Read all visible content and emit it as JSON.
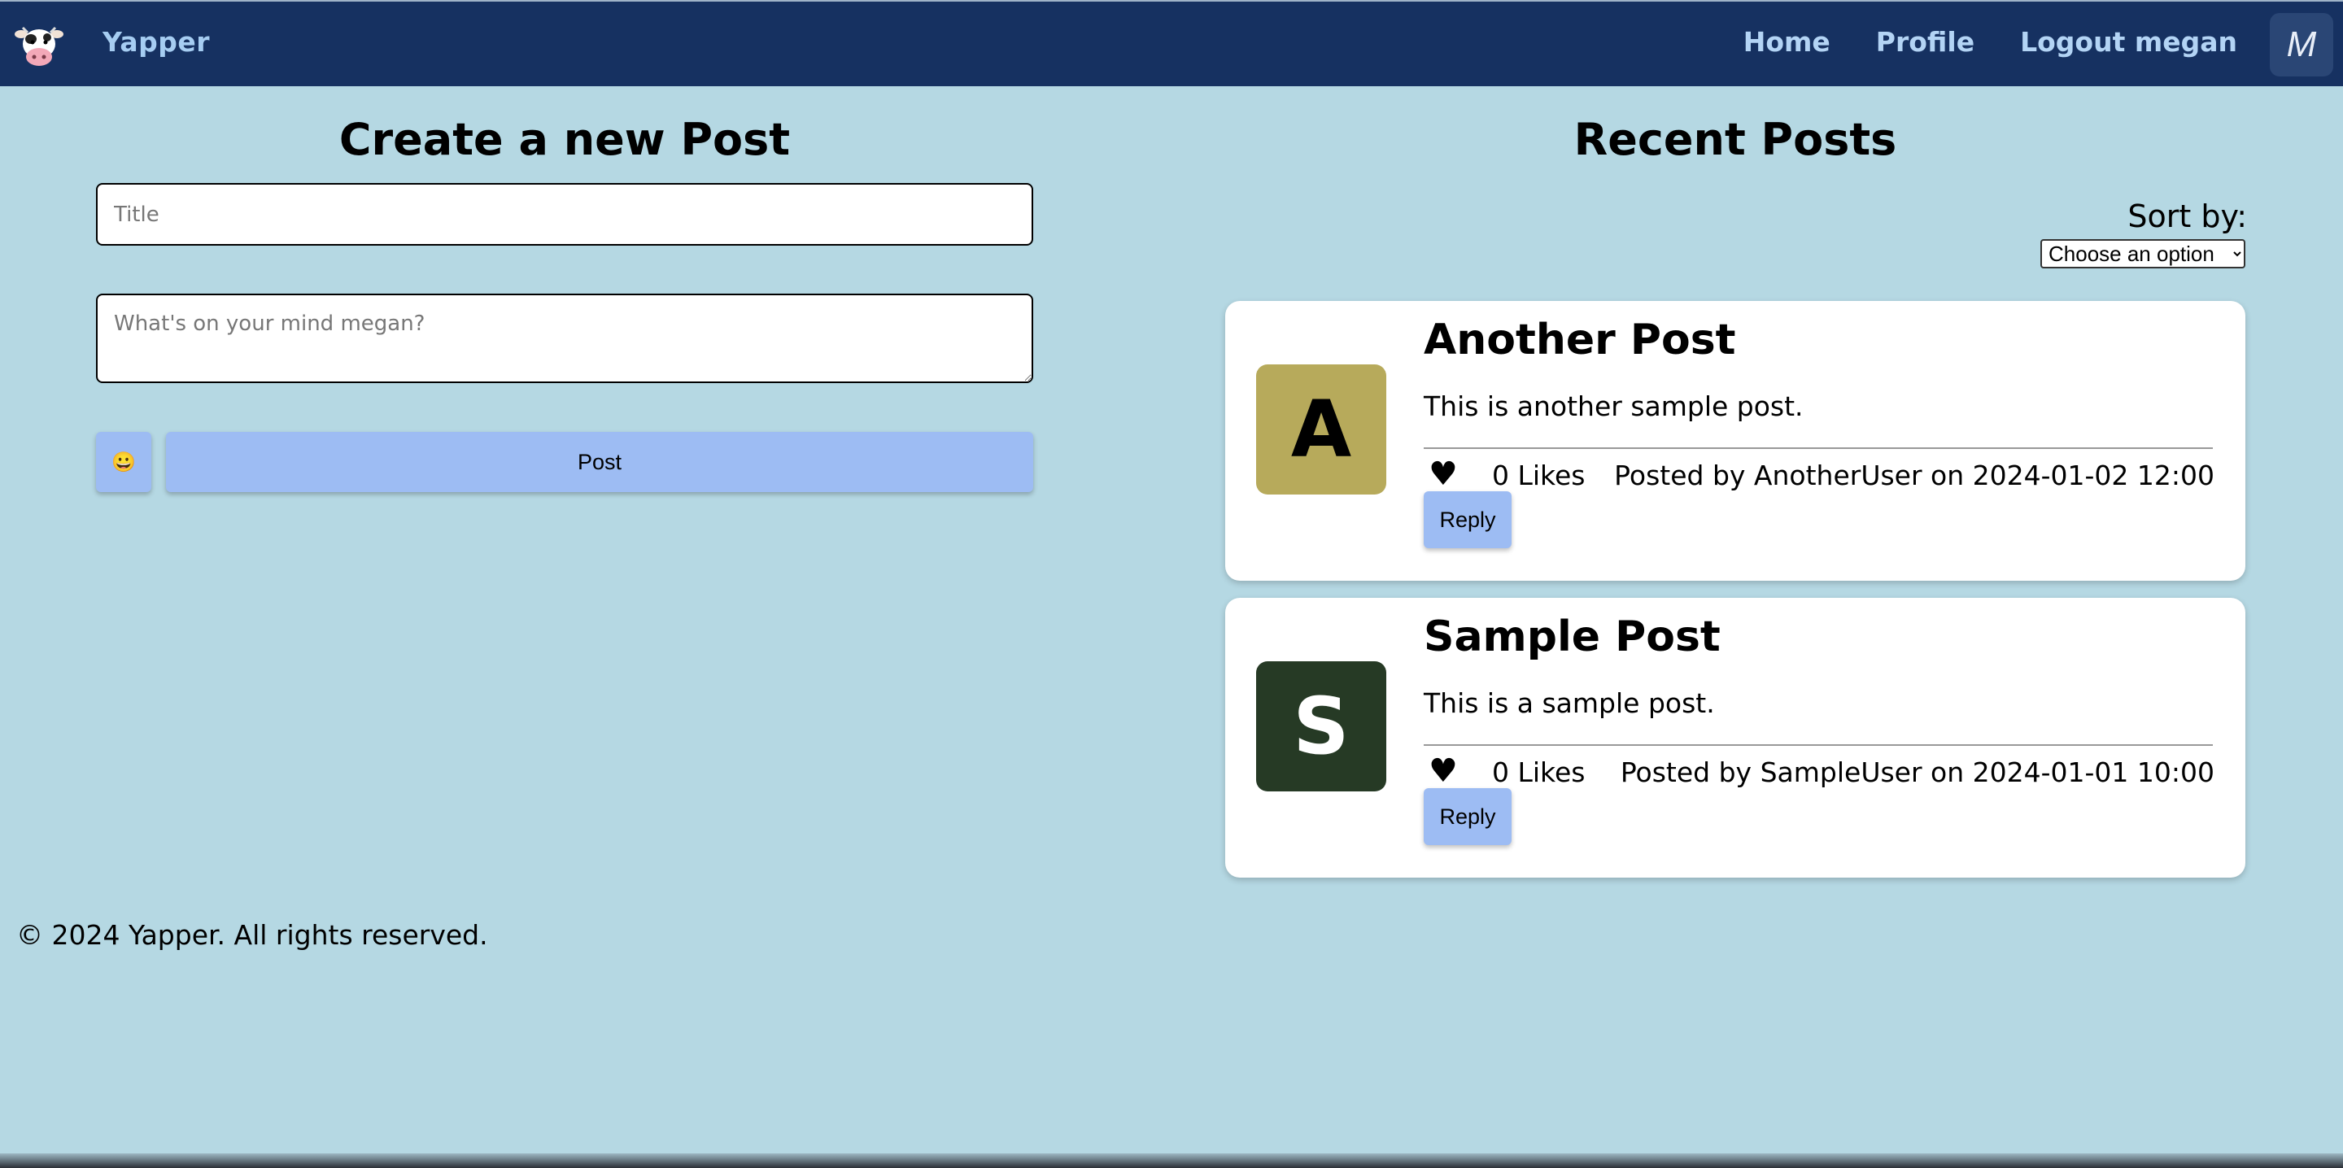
{
  "navbar": {
    "brand": "Yapper",
    "links": [
      "Home",
      "Profile",
      "Logout megan"
    ],
    "avatar_letter": "M",
    "background": "#163161"
  },
  "create": {
    "heading": "Create a new Post",
    "title_placeholder": "Title",
    "body_placeholder": "What's on your mind megan?",
    "emoji": "😀",
    "post_label": "Post"
  },
  "feed": {
    "heading": "Recent Posts",
    "sort_label": "Sort by:",
    "sort_selected": "Choose an option",
    "posts": [
      {
        "avatar_letter": "A",
        "avatar_color": "#b7aa5b",
        "avatar_text_color": "#000000",
        "title": "Another Post",
        "body": "This is another sample post.",
        "heart": "♥",
        "likes": "0 Likes",
        "meta": "Posted by AnotherUser on 2024-01-02 12:00",
        "reply_label": "Reply"
      },
      {
        "avatar_letter": "S",
        "avatar_color": "#263a25",
        "avatar_text_color": "#ffffff",
        "title": "Sample Post",
        "body": "This is a sample post.",
        "heart": "♥",
        "likes": "0 Likes",
        "meta": "Posted by SampleUser on 2024-01-01 10:00",
        "reply_label": "Reply"
      }
    ]
  },
  "footer": {
    "text": "© 2024 Yapper. All rights reserved."
  },
  "icons": {
    "logo": "cow-logo-icon",
    "heart": "heart-icon",
    "emoji": "smiley-icon"
  },
  "colors": {
    "page_bg": "#b5d8e3",
    "button_bg": "#9dbcf3",
    "nav_text": "#b3d4f5"
  }
}
